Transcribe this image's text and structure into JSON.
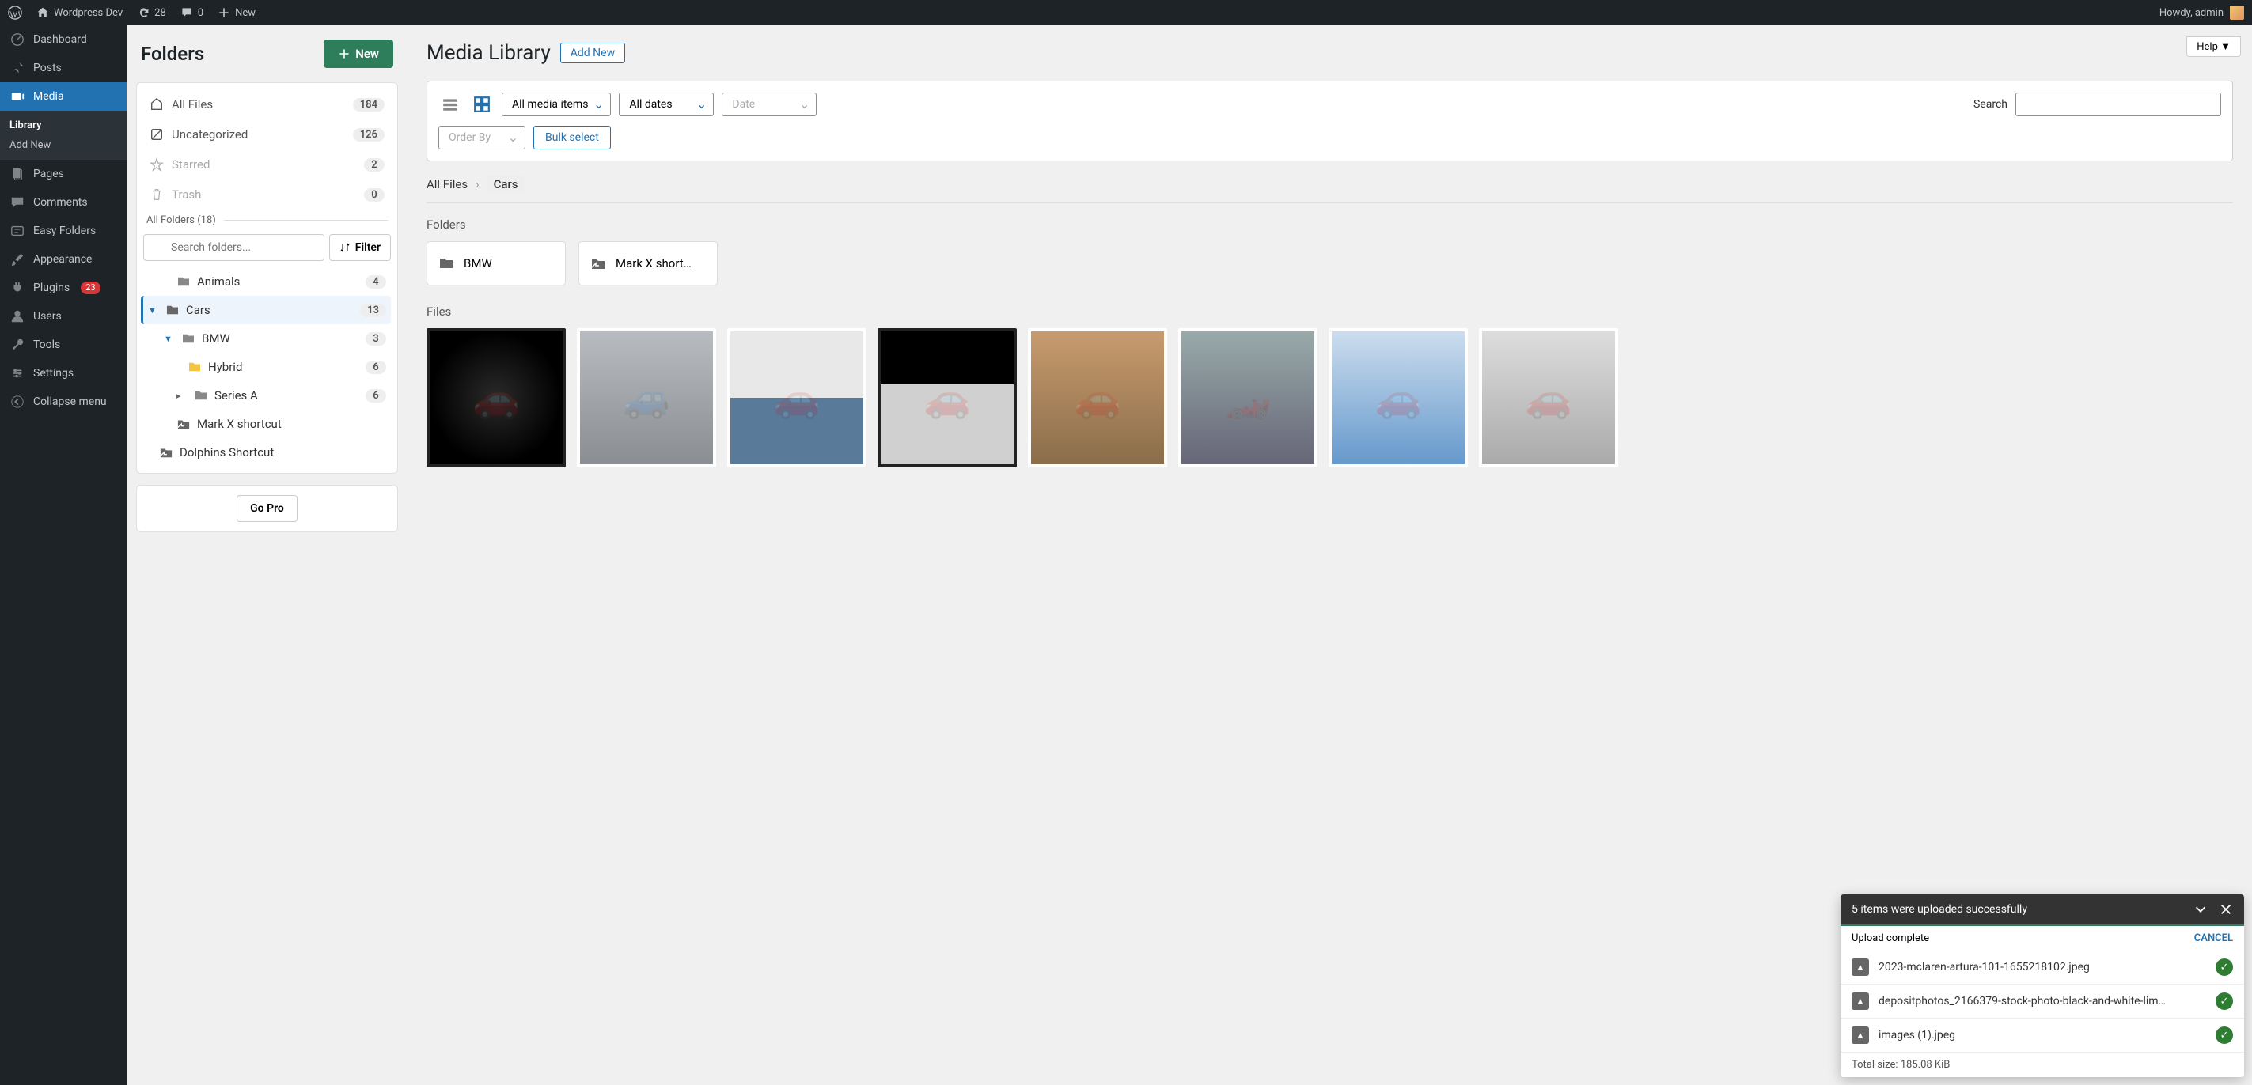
{
  "adminbar": {
    "site_name": "Wordpress Dev",
    "updates": "28",
    "comments": "0",
    "new_label": "New",
    "howdy": "Howdy, admin"
  },
  "sidebar": {
    "dashboard": "Dashboard",
    "posts": "Posts",
    "media": "Media",
    "media_library": "Library",
    "media_add": "Add New",
    "pages": "Pages",
    "comments": "Comments",
    "easy_folders": "Easy Folders",
    "appearance": "Appearance",
    "plugins": "Plugins",
    "plugins_count": "23",
    "users": "Users",
    "tools": "Tools",
    "settings": "Settings",
    "collapse": "Collapse menu"
  },
  "folders": {
    "title": "Folders",
    "new_button": "New",
    "all_files": "All Files",
    "all_files_count": "184",
    "uncategorized": "Uncategorized",
    "uncategorized_count": "126",
    "starred": "Starred",
    "starred_count": "2",
    "trash": "Trash",
    "trash_count": "0",
    "all_folders_label": "All Folders (18)",
    "search_placeholder": "Search folders...",
    "filter": "Filter",
    "tree": [
      {
        "label": "Animals",
        "count": "4"
      },
      {
        "label": "Cars",
        "count": "13"
      },
      {
        "label": "BMW",
        "count": "3"
      },
      {
        "label": "Hybrid",
        "count": "6"
      },
      {
        "label": "Series A",
        "count": "6"
      },
      {
        "label": "Mark X shortcut",
        "count": ""
      },
      {
        "label": "Dolphins Shortcut",
        "count": ""
      }
    ],
    "go_pro": "Go Pro"
  },
  "content": {
    "help": "Help",
    "page_title": "Media Library",
    "add_new": "Add New",
    "filter_media": "All media items",
    "filter_dates": "All dates",
    "filter_date2": "Date",
    "order_by": "Order By",
    "bulk_select": "Bulk select",
    "search_label": "Search",
    "crumb_root": "All Files",
    "crumb_current": "Cars",
    "folders_section": "Folders",
    "files_section": "Files",
    "folder_tiles": [
      {
        "label": "BMW",
        "icon": "folder"
      },
      {
        "label": "Mark X short…",
        "icon": "shortcut"
      }
    ]
  },
  "upload": {
    "title": "5 items were uploaded successfully",
    "status": "Upload complete",
    "cancel": "CANCEL",
    "files": [
      "2023-mclaren-artura-101-1655218102.jpeg",
      "depositphotos_2166379-stock-photo-black-and-white-lim…",
      "images (1).jpeg"
    ],
    "total": "Total size: 185.08 KiB"
  }
}
